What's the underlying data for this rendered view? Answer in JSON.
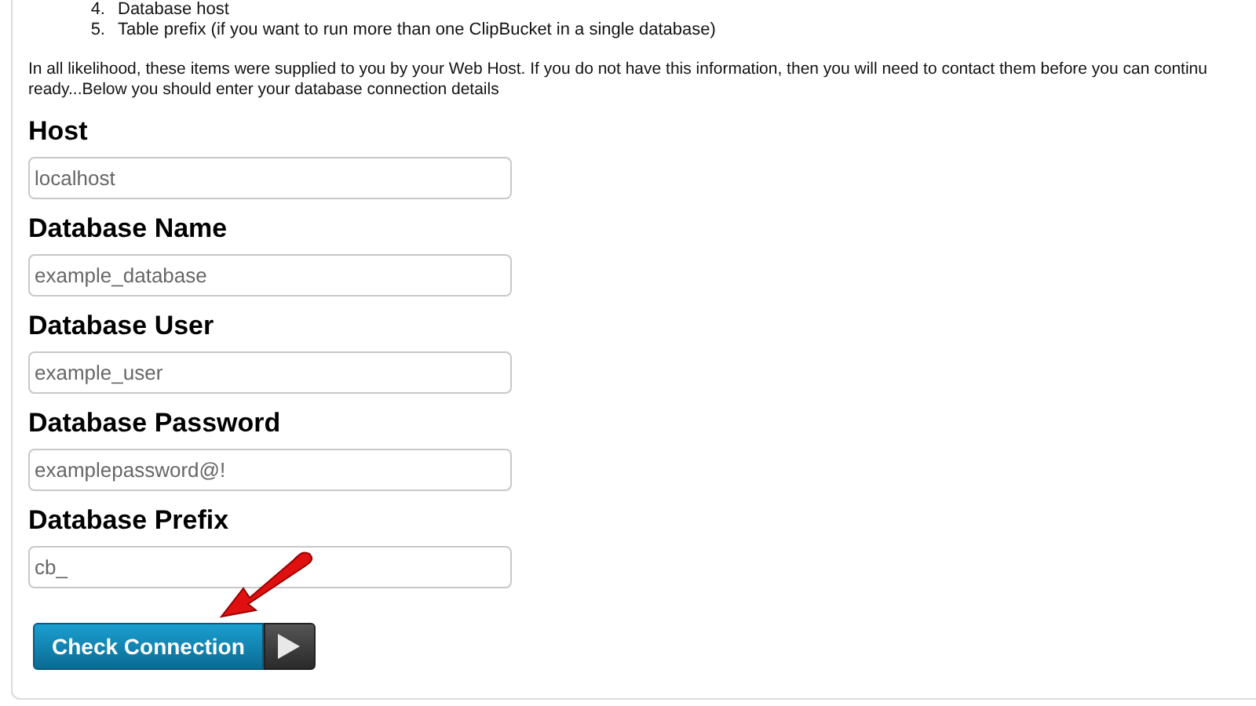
{
  "requirements": [
    {
      "number": "4.",
      "text": "Database host"
    },
    {
      "number": "5.",
      "text": "Table prefix (if you want to run more than one ClipBucket in a single database)"
    }
  ],
  "intro": [
    "In all likelihood, these items were supplied to you by your Web Host. If you do not have this information, then you will need to contact them before you can continu",
    "ready...Below you should enter your database connection details"
  ],
  "fields": [
    {
      "label": "Host",
      "value": "localhost"
    },
    {
      "label": "Database Name",
      "value": "example_database"
    },
    {
      "label": "Database User",
      "value": "example_user"
    },
    {
      "label": "Database Password",
      "value": "examplepassword@!"
    },
    {
      "label": "Database Prefix",
      "value": "cb_"
    }
  ],
  "submit": {
    "label": "Check Connection"
  }
}
